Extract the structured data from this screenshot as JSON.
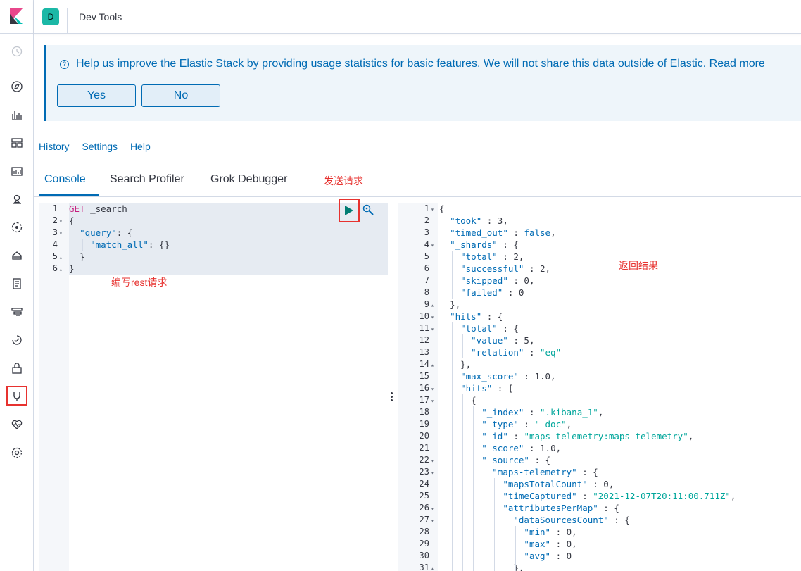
{
  "header": {
    "avatar_letter": "D",
    "title": "Dev Tools"
  },
  "callout": {
    "text": "Help us improve the Elastic Stack by providing usage statistics for basic features. We will not share this data outside of Elastic. Read more",
    "yes_label": "Yes",
    "no_label": "No"
  },
  "top_menu": [
    "History",
    "Settings",
    "Help"
  ],
  "tabs": [
    "Console",
    "Search Profiler",
    "Grok Debugger"
  ],
  "annotations": {
    "send_request": "发送请求",
    "write_request": "编写rest请求",
    "return_result": "返回结果"
  },
  "colors": {
    "accent": "#006bb4",
    "highlight_box": "#e7322f",
    "avatar": "#1bb8a6",
    "run": "#017d73"
  },
  "nav_icons": [
    "clock-icon",
    "compass-icon",
    "visualize-icon",
    "dashboard-icon",
    "canvas-icon",
    "maps-icon",
    "ml-icon",
    "infra-icon",
    "logs-icon",
    "apm-icon",
    "uptime-icon",
    "siem-icon",
    "devtools-icon",
    "monitoring-icon",
    "management-icon"
  ],
  "request_editor": {
    "lines": [
      {
        "n": "1",
        "fold": ""
      },
      {
        "n": "2",
        "fold": "▾"
      },
      {
        "n": "3",
        "fold": "▾"
      },
      {
        "n": "4",
        "fold": ""
      },
      {
        "n": "5",
        "fold": "▴"
      },
      {
        "n": "6",
        "fold": "▴"
      }
    ],
    "code": [
      [
        [
          "m",
          "GET"
        ],
        [
          "v",
          " _search"
        ]
      ],
      [
        [
          "v",
          "{"
        ]
      ],
      [
        [
          "v",
          "  "
        ],
        [
          "k",
          "\"query\""
        ],
        [
          "v",
          ": {"
        ]
      ],
      [
        [
          "v",
          "    "
        ],
        [
          "k",
          "\"match_all\""
        ],
        [
          "v",
          ": {}"
        ]
      ],
      [
        [
          "v",
          "  }"
        ]
      ],
      [
        [
          "v",
          "}"
        ]
      ]
    ]
  },
  "response_editor": {
    "lines": [
      {
        "n": "1",
        "fold": "▾"
      },
      {
        "n": "2",
        "fold": ""
      },
      {
        "n": "3",
        "fold": ""
      },
      {
        "n": "4",
        "fold": "▾"
      },
      {
        "n": "5",
        "fold": ""
      },
      {
        "n": "6",
        "fold": ""
      },
      {
        "n": "7",
        "fold": ""
      },
      {
        "n": "8",
        "fold": ""
      },
      {
        "n": "9",
        "fold": "▴"
      },
      {
        "n": "10",
        "fold": "▾"
      },
      {
        "n": "11",
        "fold": "▾"
      },
      {
        "n": "12",
        "fold": ""
      },
      {
        "n": "13",
        "fold": ""
      },
      {
        "n": "14",
        "fold": "▴"
      },
      {
        "n": "15",
        "fold": ""
      },
      {
        "n": "16",
        "fold": "▾"
      },
      {
        "n": "17",
        "fold": "▾"
      },
      {
        "n": "18",
        "fold": ""
      },
      {
        "n": "19",
        "fold": ""
      },
      {
        "n": "20",
        "fold": ""
      },
      {
        "n": "21",
        "fold": ""
      },
      {
        "n": "22",
        "fold": "▾"
      },
      {
        "n": "23",
        "fold": "▾"
      },
      {
        "n": "24",
        "fold": ""
      },
      {
        "n": "25",
        "fold": ""
      },
      {
        "n": "26",
        "fold": "▾"
      },
      {
        "n": "27",
        "fold": "▾"
      },
      {
        "n": "28",
        "fold": ""
      },
      {
        "n": "29",
        "fold": ""
      },
      {
        "n": "30",
        "fold": ""
      },
      {
        "n": "31",
        "fold": "▴"
      }
    ],
    "code": [
      [
        [
          "v",
          "{"
        ]
      ],
      [
        [
          "v",
          "  "
        ],
        [
          "k",
          "\"took\""
        ],
        [
          "v",
          " : 3,"
        ]
      ],
      [
        [
          "v",
          "  "
        ],
        [
          "k",
          "\"timed_out\""
        ],
        [
          "v",
          " : "
        ],
        [
          "k",
          "false"
        ],
        [
          "v",
          ","
        ]
      ],
      [
        [
          "v",
          "  "
        ],
        [
          "k",
          "\"_shards\""
        ],
        [
          "v",
          " : {"
        ]
      ],
      [
        [
          "v",
          "    "
        ],
        [
          "k",
          "\"total\""
        ],
        [
          "v",
          " : 2,"
        ]
      ],
      [
        [
          "v",
          "    "
        ],
        [
          "k",
          "\"successful\""
        ],
        [
          "v",
          " : 2,"
        ]
      ],
      [
        [
          "v",
          "    "
        ],
        [
          "k",
          "\"skipped\""
        ],
        [
          "v",
          " : 0,"
        ]
      ],
      [
        [
          "v",
          "    "
        ],
        [
          "k",
          "\"failed\""
        ],
        [
          "v",
          " : 0"
        ]
      ],
      [
        [
          "v",
          "  },"
        ]
      ],
      [
        [
          "v",
          "  "
        ],
        [
          "k",
          "\"hits\""
        ],
        [
          "v",
          " : {"
        ]
      ],
      [
        [
          "v",
          "    "
        ],
        [
          "k",
          "\"total\""
        ],
        [
          "v",
          " : {"
        ]
      ],
      [
        [
          "v",
          "      "
        ],
        [
          "k",
          "\"value\""
        ],
        [
          "v",
          " : 5,"
        ]
      ],
      [
        [
          "v",
          "      "
        ],
        [
          "k",
          "\"relation\""
        ],
        [
          "v",
          " : "
        ],
        [
          "s",
          "\"eq\""
        ]
      ],
      [
        [
          "v",
          "    },"
        ]
      ],
      [
        [
          "v",
          "    "
        ],
        [
          "k",
          "\"max_score\""
        ],
        [
          "v",
          " : 1.0,"
        ]
      ],
      [
        [
          "v",
          "    "
        ],
        [
          "k",
          "\"hits\""
        ],
        [
          "v",
          " : ["
        ]
      ],
      [
        [
          "v",
          "      {"
        ]
      ],
      [
        [
          "v",
          "        "
        ],
        [
          "k",
          "\"_index\""
        ],
        [
          "v",
          " : "
        ],
        [
          "s",
          "\".kibana_1\""
        ],
        [
          "v",
          ","
        ]
      ],
      [
        [
          "v",
          "        "
        ],
        [
          "k",
          "\"_type\""
        ],
        [
          "v",
          " : "
        ],
        [
          "s",
          "\"_doc\""
        ],
        [
          "v",
          ","
        ]
      ],
      [
        [
          "v",
          "        "
        ],
        [
          "k",
          "\"_id\""
        ],
        [
          "v",
          " : "
        ],
        [
          "s",
          "\"maps-telemetry:maps-telemetry\""
        ],
        [
          "v",
          ","
        ]
      ],
      [
        [
          "v",
          "        "
        ],
        [
          "k",
          "\"_score\""
        ],
        [
          "v",
          " : 1.0,"
        ]
      ],
      [
        [
          "v",
          "        "
        ],
        [
          "k",
          "\"_source\""
        ],
        [
          "v",
          " : {"
        ]
      ],
      [
        [
          "v",
          "          "
        ],
        [
          "k",
          "\"maps-telemetry\""
        ],
        [
          "v",
          " : {"
        ]
      ],
      [
        [
          "v",
          "            "
        ],
        [
          "k",
          "\"mapsTotalCount\""
        ],
        [
          "v",
          " : 0,"
        ]
      ],
      [
        [
          "v",
          "            "
        ],
        [
          "k",
          "\"timeCaptured\""
        ],
        [
          "v",
          " : "
        ],
        [
          "s",
          "\"2021-12-07T20:11:00.711Z\""
        ],
        [
          "v",
          ","
        ]
      ],
      [
        [
          "v",
          "            "
        ],
        [
          "k",
          "\"attributesPerMap\""
        ],
        [
          "v",
          " : {"
        ]
      ],
      [
        [
          "v",
          "              "
        ],
        [
          "k",
          "\"dataSourcesCount\""
        ],
        [
          "v",
          " : {"
        ]
      ],
      [
        [
          "v",
          "                "
        ],
        [
          "k",
          "\"min\""
        ],
        [
          "v",
          " : 0,"
        ]
      ],
      [
        [
          "v",
          "                "
        ],
        [
          "k",
          "\"max\""
        ],
        [
          "v",
          " : 0,"
        ]
      ],
      [
        [
          "v",
          "                "
        ],
        [
          "k",
          "\"avg\""
        ],
        [
          "v",
          " : 0"
        ]
      ],
      [
        [
          "v",
          "              },"
        ]
      ]
    ]
  }
}
